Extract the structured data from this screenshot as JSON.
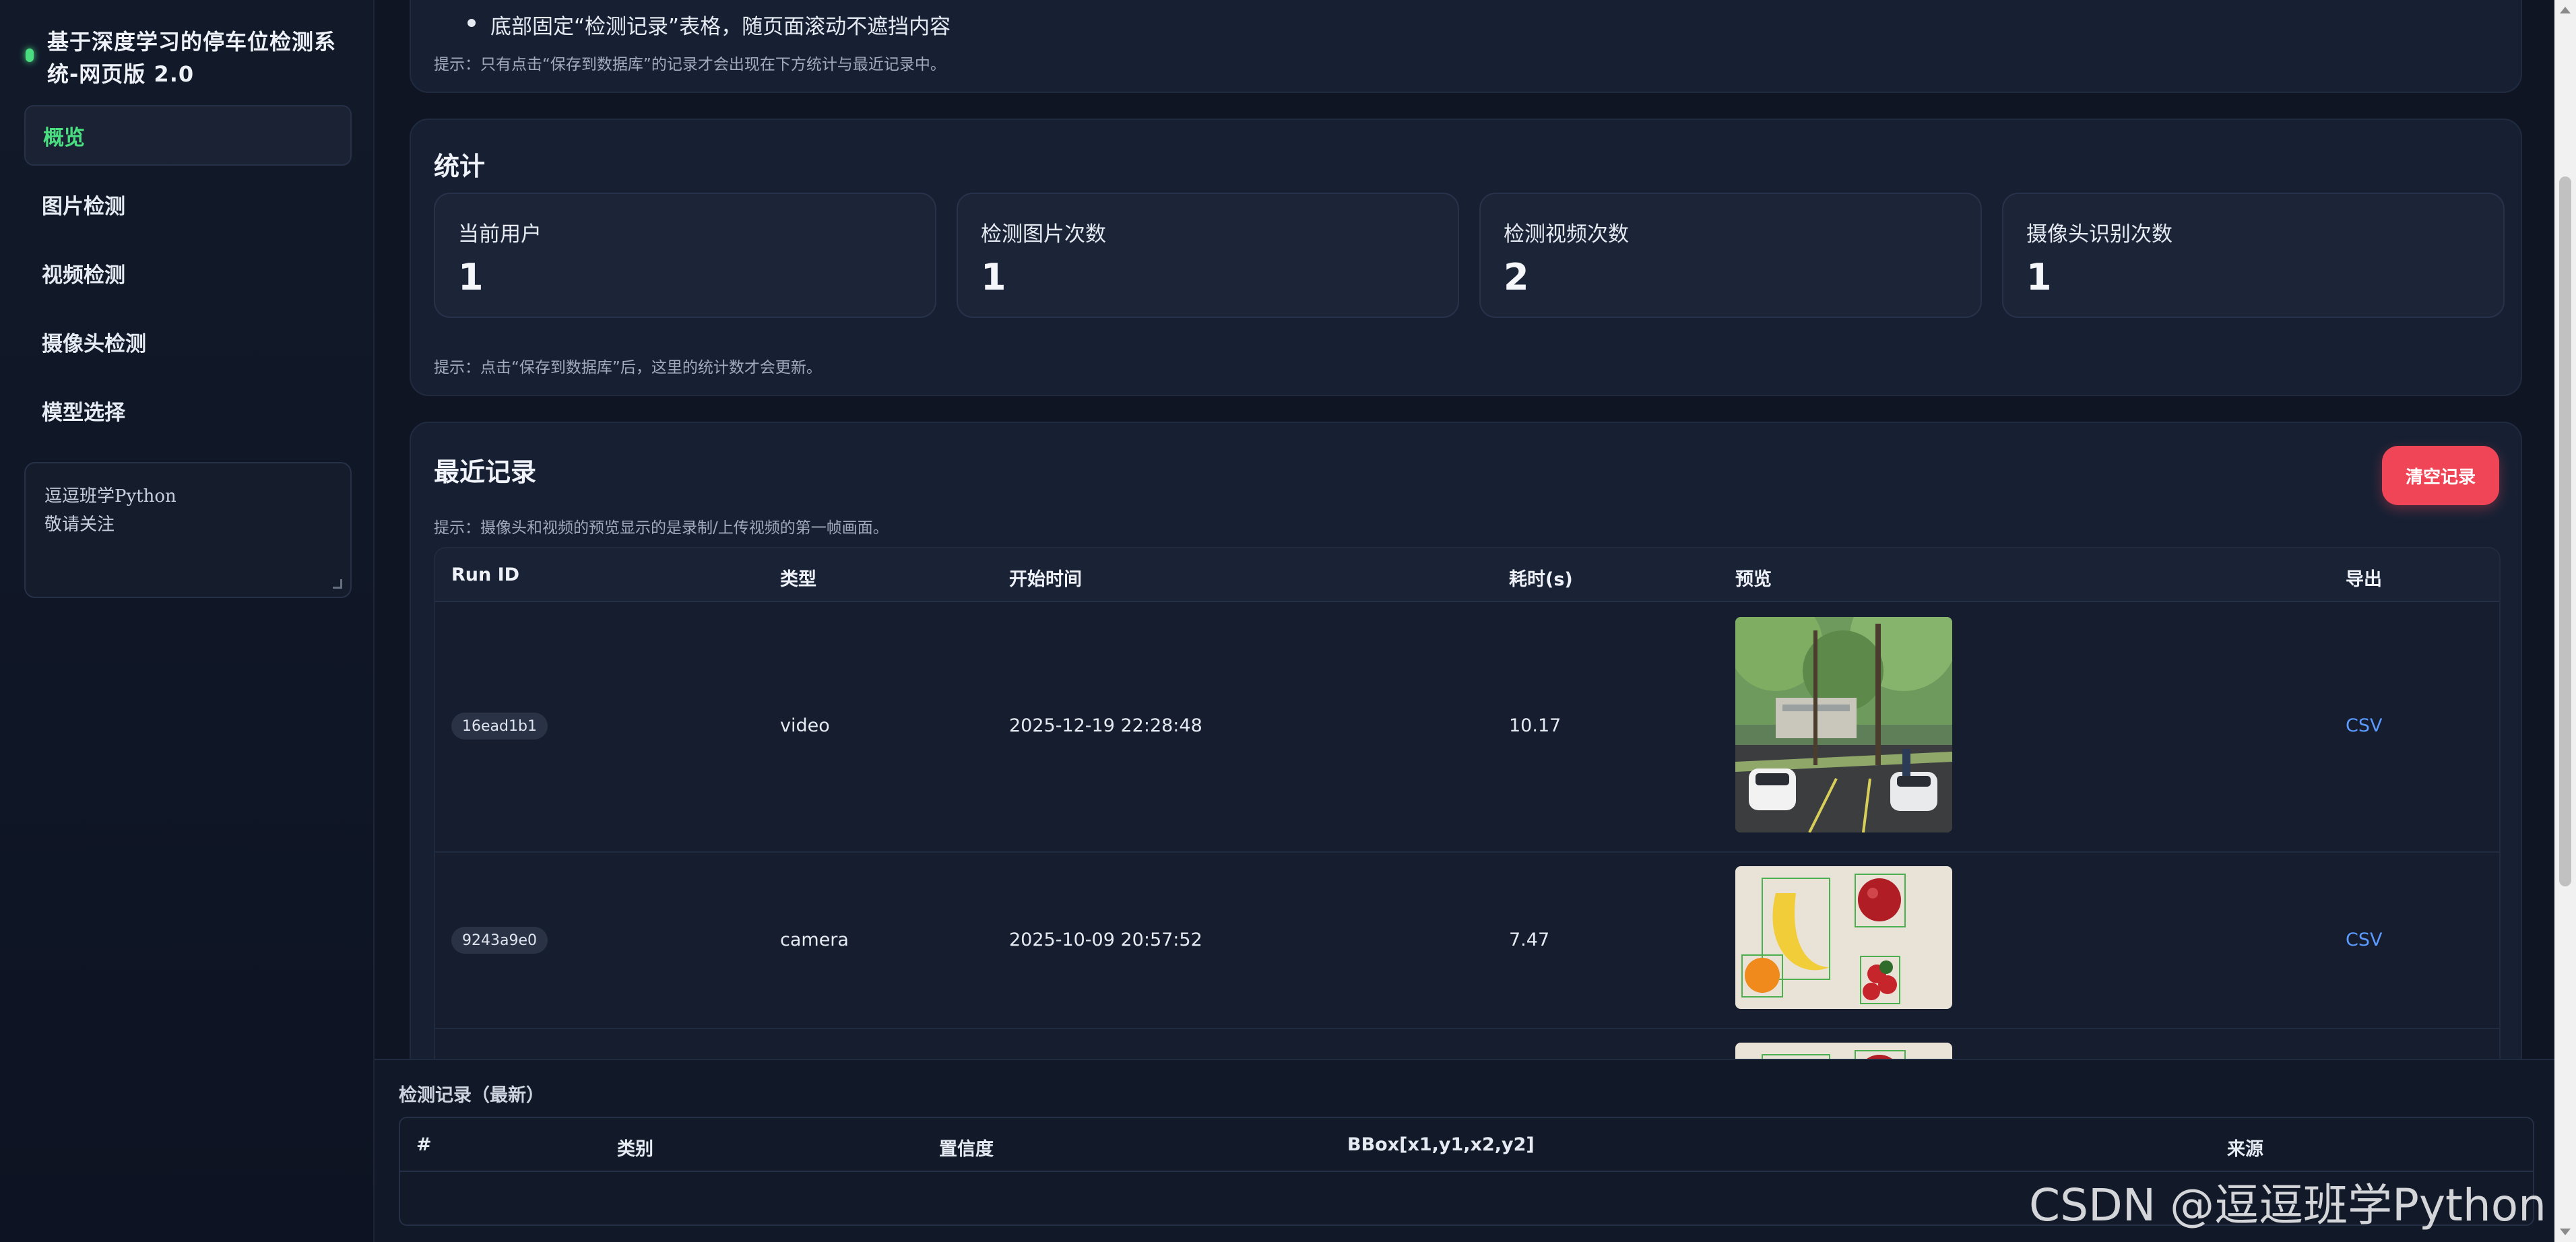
{
  "sidebar": {
    "title": "基于深度学习的停车位检测系统-网页版 2.0",
    "items": [
      {
        "label": "概览",
        "active": true
      },
      {
        "label": "图片检测"
      },
      {
        "label": "视频检测"
      },
      {
        "label": "摄像头检测"
      },
      {
        "label": "模型选择"
      }
    ],
    "note": "逗逗班学Python\n敬请关注"
  },
  "intro": {
    "bullet": "底部固定“检测记录”表格，随页面滚动不遮挡内容",
    "hint": "提示：只有点击“保存到数据库”的记录才会出现在下方统计与最近记录中。"
  },
  "stats": {
    "title": "统计",
    "boxes": [
      {
        "label": "当前用户",
        "value": "1"
      },
      {
        "label": "检测图片次数",
        "value": "1"
      },
      {
        "label": "检测视频次数",
        "value": "2"
      },
      {
        "label": "摄像头识别次数",
        "value": "1"
      }
    ],
    "hint": "提示：点击“保存到数据库”后，这里的统计数才会更新。"
  },
  "recent": {
    "title": "最近记录",
    "clear_label": "清空记录",
    "hint": "提示：摄像头和视频的预览显示的是录制/上传视频的第一帧画面。",
    "columns": [
      "Run ID",
      "类型",
      "开始时间",
      "耗时(s)",
      "预览",
      "导出"
    ],
    "rows": [
      {
        "run_id": "16ead1b1",
        "type": "video",
        "start": "2025-12-19 22:28:48",
        "duration": "10.17",
        "export": "CSV"
      },
      {
        "run_id": "9243a9e0",
        "type": "camera",
        "start": "2025-10-09 20:57:52",
        "duration": "7.47",
        "export": "CSV"
      }
    ]
  },
  "bottom": {
    "title": "检测记录（最新）",
    "columns": [
      "#",
      "类别",
      "置信度",
      "BBox[x1,y1,x2,y2]",
      "来源"
    ]
  },
  "watermark": "CSDN @逗逗班学Python",
  "colors": {
    "accent": "#4ade80",
    "danger": "#ef4556",
    "link": "#5b9bff"
  }
}
